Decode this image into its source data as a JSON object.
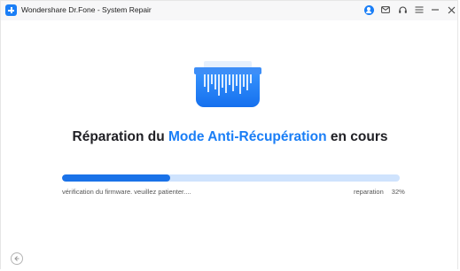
{
  "window": {
    "title": "Wondershare Dr.Fone - System Repair",
    "icons": [
      "account-icon",
      "mail-icon",
      "support-icon",
      "menu-icon",
      "minimize-icon",
      "close-icon"
    ]
  },
  "main": {
    "heading_prefix": "Réparation du ",
    "heading_accent": "Mode Anti-Récupération",
    "heading_suffix": " en cours",
    "status_text": "vérification du firmware. veuillez patienter....",
    "progress_label": "reparation",
    "progress_percent_text": "32%",
    "progress_fraction": 0.32,
    "back_icon": "back-arrow-icon"
  },
  "colors": {
    "accent": "#1a7ef6",
    "progress_track": "#cfe3fd",
    "progress_fill": "#1a72e8"
  }
}
